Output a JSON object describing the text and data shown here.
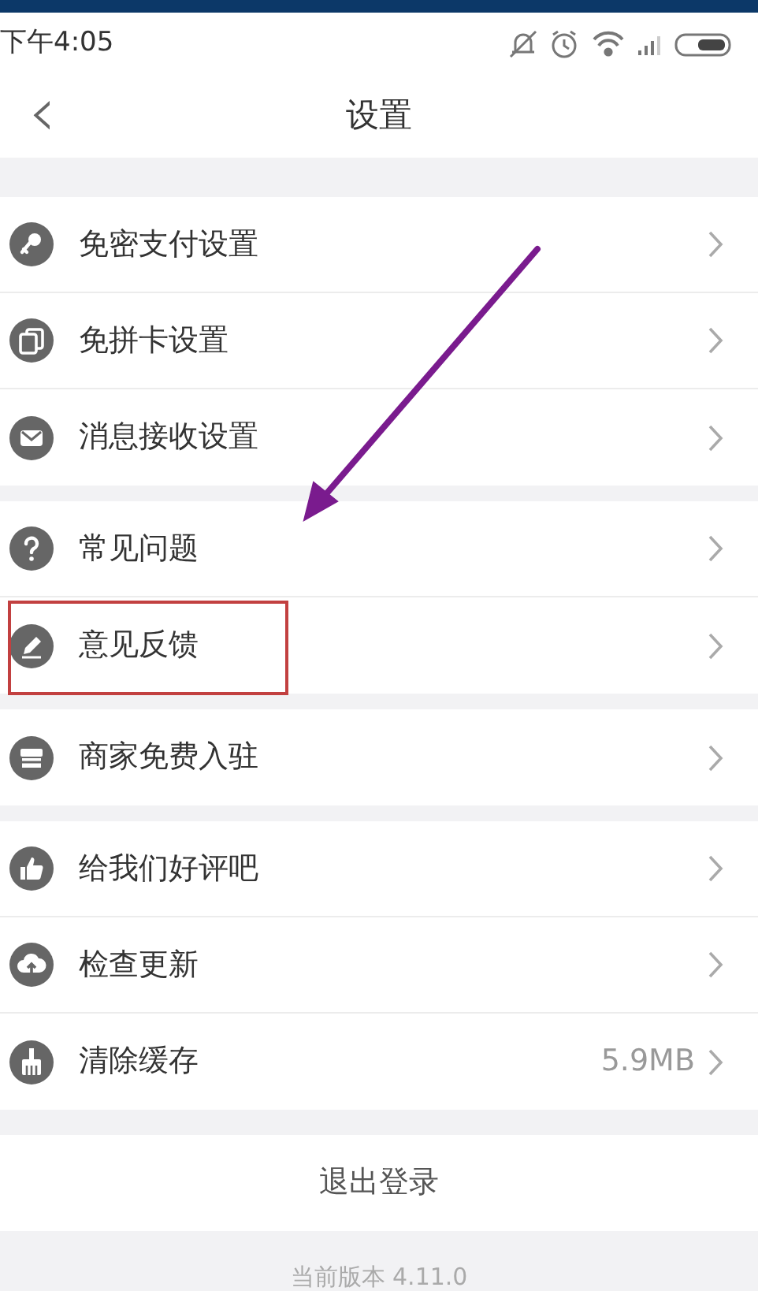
{
  "status_bar": {
    "time": "下午4:05"
  },
  "header": {
    "back": "‹",
    "title": "设置"
  },
  "groups": [
    {
      "items": [
        {
          "label": "免密支付设置",
          "highlighted": false
        },
        {
          "label": "免拼卡设置",
          "highlighted": false
        },
        {
          "label": "消息接收设置",
          "highlighted": false
        }
      ]
    },
    {
      "items": [
        {
          "label": "常见问题",
          "highlighted": false
        },
        {
          "label": "意见反馈",
          "highlighted": true
        }
      ]
    },
    {
      "items": [
        {
          "label": "商家免费入驻",
          "highlighted": false
        }
      ]
    },
    {
      "items": [
        {
          "label": "给我们好评吧",
          "highlighted": false
        },
        {
          "label": "检查更新",
          "highlighted": false
        },
        {
          "label": "清除缓存",
          "value": "5.9MB",
          "highlighted": false
        }
      ]
    }
  ],
  "logout": "退出登录",
  "version": "当前版本 4.11.0",
  "annotations": [
    {
      "kind": "arrow",
      "color": "#7a1b8e"
    }
  ]
}
